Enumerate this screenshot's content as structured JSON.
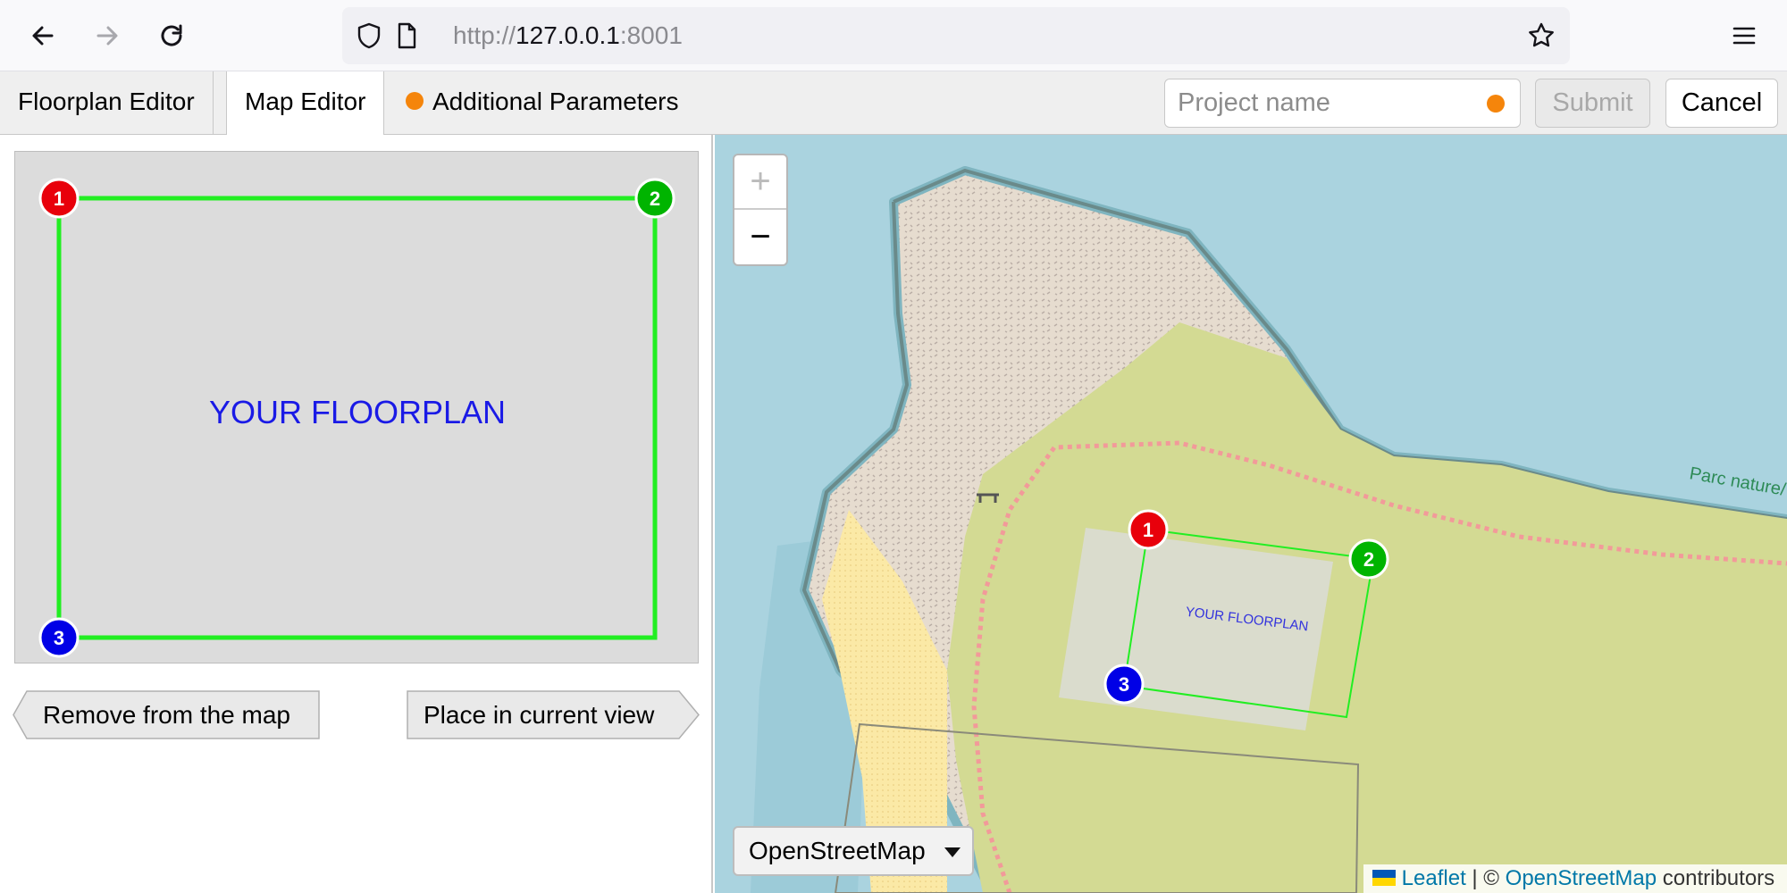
{
  "browser": {
    "url_prefix": "http://",
    "url_host": "127.0.0.1",
    "url_port": ":8001"
  },
  "tabs": [
    {
      "label": "Floorplan Editor"
    },
    {
      "label": "Map Editor"
    },
    {
      "label": "Additional Parameters"
    }
  ],
  "header": {
    "project_placeholder": "Project name",
    "submit_label": "Submit",
    "cancel_label": "Cancel"
  },
  "floorplan": {
    "label": "YOUR FLOORPLAN",
    "markers": [
      "1",
      "2",
      "3"
    ],
    "remove_label": "Remove from the map",
    "place_label": "Place in current view"
  },
  "map": {
    "zoom_in": "+",
    "zoom_out": "−",
    "layer": "OpenStreetMap",
    "place_label": "Parc nature/",
    "overlay_label": "YOUR FLOORPLAN",
    "attribution": {
      "leaflet": "Leaflet",
      "sep": " | © ",
      "osm": "OpenStreetMap",
      "suffix": " contributors"
    }
  },
  "colors": {
    "marker1": "#e8000b",
    "marker2": "#00b400",
    "marker3": "#0000e6",
    "status_dot": "#f5850b",
    "outline": "#22ee22",
    "water": "#aad3df"
  }
}
